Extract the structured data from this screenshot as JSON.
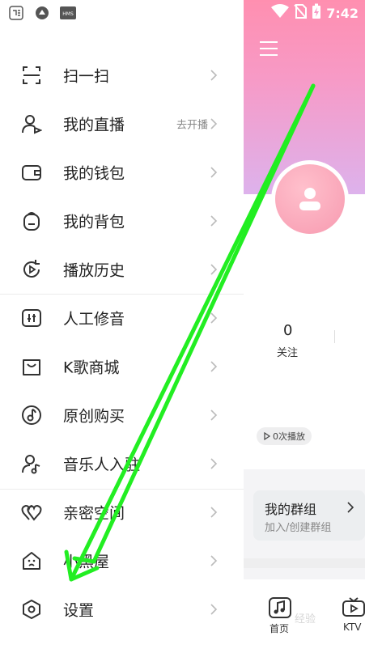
{
  "status_bar": {
    "left_icons": [
      "message-app-icon",
      "shortcut-app-icon",
      "hms-app-icon"
    ],
    "hms_text": "HMS",
    "right_icons": [
      "wifi-icon",
      "no-sim-icon",
      "battery-charging-icon"
    ],
    "time": "7:42"
  },
  "drawer": {
    "items": [
      {
        "label": "扫一扫",
        "icon": "scan-icon",
        "sub": ""
      },
      {
        "label": "我的直播",
        "icon": "live-user-icon",
        "sub": "去开播"
      },
      {
        "label": "我的钱包",
        "icon": "wallet-icon",
        "sub": ""
      },
      {
        "label": "我的背包",
        "icon": "backpack-icon",
        "sub": ""
      },
      {
        "label": "播放历史",
        "icon": "history-icon",
        "sub": ""
      },
      {
        "label": "人工修音",
        "icon": "tune-icon",
        "sub": ""
      },
      {
        "label": "K歌商城",
        "icon": "shop-bag-icon",
        "sub": ""
      },
      {
        "label": "原创购买",
        "icon": "music-note-icon",
        "sub": ""
      },
      {
        "label": "音乐人入驻",
        "icon": "musician-icon",
        "sub": ""
      },
      {
        "label": "亲密空间",
        "icon": "hearts-icon",
        "sub": ""
      },
      {
        "label": "小黑屋",
        "icon": "house-face-icon",
        "sub": ""
      },
      {
        "label": "设置",
        "icon": "settings-hex-icon",
        "sub": ""
      }
    ]
  },
  "profile": {
    "following_count": "0",
    "following_label": "关注",
    "plays_label": "0次播放",
    "group_title": "我的群组",
    "group_sub": "加入/创建群组"
  },
  "tabbar": {
    "home_label": "首页",
    "ktv_label": "KTV"
  },
  "watermark": "经验",
  "colors": {
    "arrow": "#22ee22",
    "pink_gradient_top": "#ff8fb0",
    "pink_gradient_bottom": "#ddb2ec",
    "avatar": "#f79ab0"
  }
}
